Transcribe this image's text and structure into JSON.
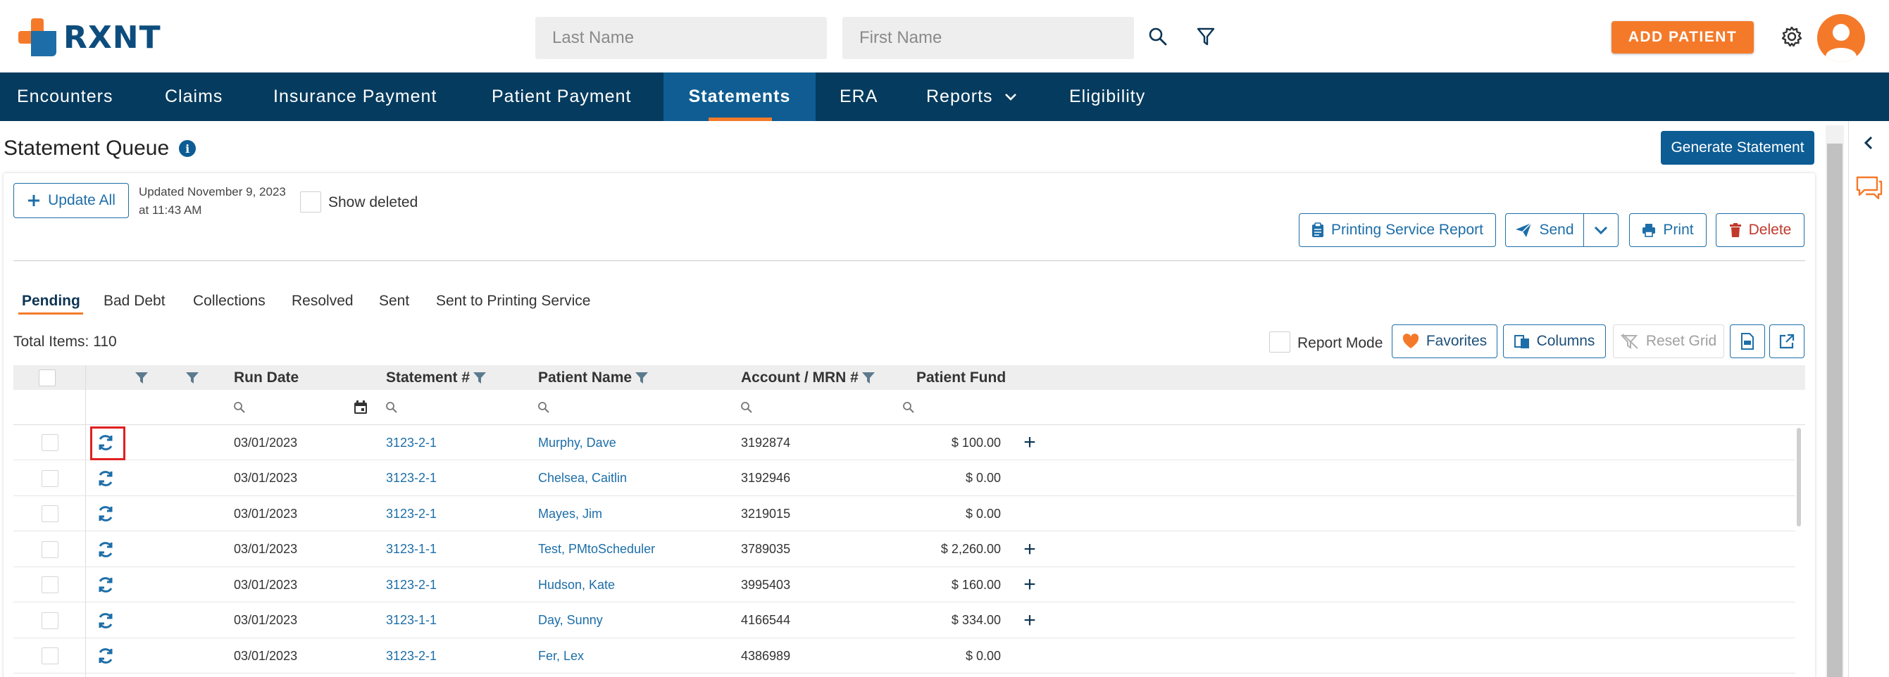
{
  "brand": {
    "name": "RXNT"
  },
  "search": {
    "last_name_placeholder": "Last Name",
    "first_name_placeholder": "First Name"
  },
  "header": {
    "add_patient_label": "ADD PATIENT"
  },
  "nav": {
    "items": [
      {
        "label": "Encounters"
      },
      {
        "label": "Claims"
      },
      {
        "label": "Insurance Payment"
      },
      {
        "label": "Patient Payment"
      },
      {
        "label": "Statements",
        "active": true
      },
      {
        "label": "ERA"
      },
      {
        "label": "Reports"
      },
      {
        "label": "Eligibility"
      }
    ]
  },
  "page": {
    "title": "Statement Queue",
    "generate_label": "Generate Statement",
    "update_all_label": "Update All",
    "updated_text": "Updated November 9, 2023 at 11:43 AM",
    "show_deleted_label": "Show deleted",
    "printing_report_label": "Printing Service Report",
    "send_label": "Send",
    "print_label": "Print",
    "delete_label": "Delete"
  },
  "subtabs": [
    "Pending",
    "Bad Debt",
    "Collections",
    "Resolved",
    "Sent",
    "Sent to Printing Service"
  ],
  "grid_toolbar": {
    "total_items": "Total Items: 110",
    "report_mode_label": "Report Mode",
    "favorites_label": "Favorites",
    "columns_label": "Columns",
    "reset_grid_label": "Reset Grid"
  },
  "grid": {
    "columns": [
      "Run Date",
      "Statement #",
      "Patient Name",
      "Account / MRN #",
      "Patient Fund"
    ],
    "rows": [
      {
        "run_date": "03/01/2023",
        "statement": "3123-2-1",
        "patient": "Murphy, Dave",
        "account": "3192874",
        "fund": "$ 100.00",
        "plus": true
      },
      {
        "run_date": "03/01/2023",
        "statement": "3123-2-1",
        "patient": "Chelsea, Caitlin",
        "account": "3192946",
        "fund": "$ 0.00",
        "plus": false
      },
      {
        "run_date": "03/01/2023",
        "statement": "3123-2-1",
        "patient": "Mayes, Jim",
        "account": "3219015",
        "fund": "$ 0.00",
        "plus": false
      },
      {
        "run_date": "03/01/2023",
        "statement": "3123-1-1",
        "patient": "Test, PMtoScheduler",
        "account": "3789035",
        "fund": "$ 2,260.00",
        "plus": true
      },
      {
        "run_date": "03/01/2023",
        "statement": "3123-2-1",
        "patient": "Hudson, Kate",
        "account": "3995403",
        "fund": "$ 160.00",
        "plus": true
      },
      {
        "run_date": "03/01/2023",
        "statement": "3123-1-1",
        "patient": "Day, Sunny",
        "account": "4166544",
        "fund": "$ 334.00",
        "plus": true
      },
      {
        "run_date": "03/01/2023",
        "statement": "3123-2-1",
        "patient": "Fer, Lex",
        "account": "4386989",
        "fund": "$ 0.00",
        "plus": false
      }
    ]
  },
  "colors": {
    "brand_orange": "#f47a2a",
    "nav_dark": "#053b5e",
    "nav_active": "#0f5d92",
    "link_blue": "#1d6ea8"
  }
}
